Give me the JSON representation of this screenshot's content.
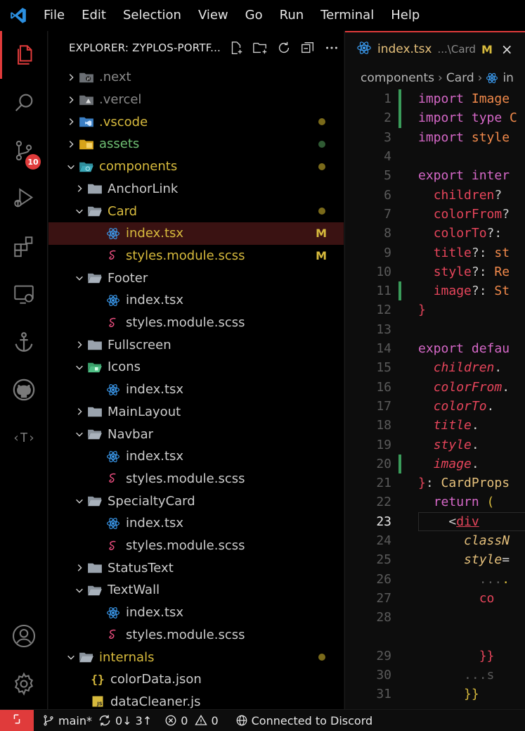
{
  "titlebar": {
    "menu": [
      "File",
      "Edit",
      "Selection",
      "View",
      "Go",
      "Run",
      "Terminal",
      "Help"
    ]
  },
  "activity_bar": {
    "icons": [
      "explorer-icon",
      "search-icon",
      "source-control-icon",
      "run-debug-icon",
      "extensions-icon",
      "remote-explorer-icon",
      "anchor-icon",
      "github-icon",
      "tag-icon",
      "account-icon",
      "settings-gear-icon"
    ],
    "scm_badge": "10"
  },
  "explorer": {
    "title": "EXPLORER: ZYPLOS-PORTF...",
    "header_icons": [
      "new-file-icon",
      "new-folder-icon",
      "refresh-icon",
      "collapse-all-icon",
      "more-icon"
    ],
    "rows": [
      {
        "label": ".next",
        "depth": 0,
        "kind": "folder",
        "expanded": false,
        "color": "#8a8a8a",
        "icon": "next-folder-icon",
        "dot": null,
        "deco": ""
      },
      {
        "label": ".vercel",
        "depth": 0,
        "kind": "folder",
        "expanded": false,
        "color": "#8a8a8a",
        "icon": "vercel-folder-icon",
        "dot": null,
        "deco": ""
      },
      {
        "label": ".vscode",
        "depth": 0,
        "kind": "folder",
        "expanded": false,
        "color": "#d7ba3d",
        "icon": "vscode-folder-icon",
        "dot": "#7a6a1a",
        "deco": ""
      },
      {
        "label": "assets",
        "depth": 0,
        "kind": "folder",
        "expanded": false,
        "color": "#6fbf73",
        "icon": "assets-folder-icon",
        "dot": "#2f5a33",
        "deco": ""
      },
      {
        "label": "components",
        "depth": 0,
        "kind": "folder",
        "expanded": true,
        "color": "#d7ba3d",
        "icon": "components-folder-icon",
        "dot": "#7a6a1a",
        "deco": ""
      },
      {
        "label": "AnchorLink",
        "depth": 1,
        "kind": "folder",
        "expanded": false,
        "color": "#cccccc",
        "icon": "folder-icon",
        "dot": null,
        "deco": ""
      },
      {
        "label": "Card",
        "depth": 1,
        "kind": "folder",
        "expanded": true,
        "color": "#d7ba3d",
        "icon": "folder-open-icon",
        "dot": "#7a6a1a",
        "deco": ""
      },
      {
        "label": "index.tsx",
        "depth": 2,
        "kind": "tsx",
        "color": "#d7ba3d",
        "icon": "react-icon",
        "dot": null,
        "deco": "M",
        "selected": true
      },
      {
        "label": "styles.module.scss",
        "depth": 2,
        "kind": "scss",
        "color": "#d7ba3d",
        "icon": "sass-icon",
        "dot": null,
        "deco": "M"
      },
      {
        "label": "Footer",
        "depth": 1,
        "kind": "folder",
        "expanded": true,
        "color": "#cccccc",
        "icon": "folder-open-icon",
        "dot": null,
        "deco": ""
      },
      {
        "label": "index.tsx",
        "depth": 2,
        "kind": "tsx",
        "color": "#cccccc",
        "icon": "react-icon",
        "dot": null,
        "deco": ""
      },
      {
        "label": "styles.module.scss",
        "depth": 2,
        "kind": "scss",
        "color": "#cccccc",
        "icon": "sass-icon",
        "dot": null,
        "deco": ""
      },
      {
        "label": "Fullscreen",
        "depth": 1,
        "kind": "folder",
        "expanded": false,
        "color": "#cccccc",
        "icon": "folder-icon",
        "dot": null,
        "deco": ""
      },
      {
        "label": "Icons",
        "depth": 1,
        "kind": "folder",
        "expanded": true,
        "color": "#cccccc",
        "icon": "icons-folder-icon",
        "dot": null,
        "deco": ""
      },
      {
        "label": "index.tsx",
        "depth": 2,
        "kind": "tsx",
        "color": "#cccccc",
        "icon": "react-icon",
        "dot": null,
        "deco": ""
      },
      {
        "label": "MainLayout",
        "depth": 1,
        "kind": "folder",
        "expanded": false,
        "color": "#cccccc",
        "icon": "folder-icon",
        "dot": null,
        "deco": ""
      },
      {
        "label": "Navbar",
        "depth": 1,
        "kind": "folder",
        "expanded": true,
        "color": "#cccccc",
        "icon": "folder-open-icon",
        "dot": null,
        "deco": ""
      },
      {
        "label": "index.tsx",
        "depth": 2,
        "kind": "tsx",
        "color": "#cccccc",
        "icon": "react-icon",
        "dot": null,
        "deco": ""
      },
      {
        "label": "styles.module.scss",
        "depth": 2,
        "kind": "scss",
        "color": "#cccccc",
        "icon": "sass-icon",
        "dot": null,
        "deco": ""
      },
      {
        "label": "SpecialtyCard",
        "depth": 1,
        "kind": "folder",
        "expanded": true,
        "color": "#cccccc",
        "icon": "folder-open-icon",
        "dot": null,
        "deco": ""
      },
      {
        "label": "index.tsx",
        "depth": 2,
        "kind": "tsx",
        "color": "#cccccc",
        "icon": "react-icon",
        "dot": null,
        "deco": ""
      },
      {
        "label": "styles.module.scss",
        "depth": 2,
        "kind": "scss",
        "color": "#cccccc",
        "icon": "sass-icon",
        "dot": null,
        "deco": ""
      },
      {
        "label": "StatusText",
        "depth": 1,
        "kind": "folder",
        "expanded": false,
        "color": "#cccccc",
        "icon": "folder-icon",
        "dot": null,
        "deco": ""
      },
      {
        "label": "TextWall",
        "depth": 1,
        "kind": "folder",
        "expanded": true,
        "color": "#cccccc",
        "icon": "folder-open-icon",
        "dot": null,
        "deco": ""
      },
      {
        "label": "index.tsx",
        "depth": 2,
        "kind": "tsx",
        "color": "#cccccc",
        "icon": "react-icon",
        "dot": null,
        "deco": ""
      },
      {
        "label": "styles.module.scss",
        "depth": 2,
        "kind": "scss",
        "color": "#cccccc",
        "icon": "sass-icon",
        "dot": null,
        "deco": ""
      },
      {
        "label": "internals",
        "depth": 0,
        "kind": "folder",
        "expanded": true,
        "color": "#d7ba3d",
        "icon": "folder-open-icon",
        "dot": "#7a6a1a",
        "deco": ""
      },
      {
        "label": "colorData.json",
        "depth": 1,
        "kind": "json",
        "color": "#cccccc",
        "icon": "json-icon",
        "dot": null,
        "deco": ""
      },
      {
        "label": "dataCleaner.js",
        "depth": 1,
        "kind": "js",
        "color": "#cccccc",
        "icon": "js-icon",
        "dot": null,
        "deco": ""
      }
    ]
  },
  "editor": {
    "tab": {
      "name": "index.tsx",
      "path": "...\\Card",
      "status": "M",
      "close": "×"
    },
    "breadcrumbs": [
      "components",
      "Card",
      "in"
    ],
    "active_line": 23,
    "lines": [
      {
        "n": "1",
        "mod": true,
        "tokens": [
          [
            "kw",
            "import "
          ],
          [
            "ty",
            "Image"
          ]
        ]
      },
      {
        "n": "2",
        "mod": true,
        "tokens": [
          [
            "kw",
            "import "
          ],
          [
            "kw",
            "type "
          ],
          [
            "ty",
            "C"
          ]
        ]
      },
      {
        "n": "3",
        "mod": false,
        "tokens": [
          [
            "kw",
            "import "
          ],
          [
            "ty",
            "style"
          ]
        ]
      },
      {
        "n": "4",
        "mod": false,
        "tokens": []
      },
      {
        "n": "5",
        "mod": false,
        "tokens": [
          [
            "kw",
            "export "
          ],
          [
            "kw",
            "inter"
          ]
        ]
      },
      {
        "n": "6",
        "mod": false,
        "tokens": [
          [
            "punc",
            "  "
          ],
          [
            "prop",
            "children"
          ],
          [
            "punc",
            "?"
          ]
        ]
      },
      {
        "n": "7",
        "mod": false,
        "tokens": [
          [
            "punc",
            "  "
          ],
          [
            "prop",
            "colorFrom"
          ],
          [
            "punc",
            "?"
          ]
        ]
      },
      {
        "n": "8",
        "mod": false,
        "tokens": [
          [
            "punc",
            "  "
          ],
          [
            "prop",
            "colorTo"
          ],
          [
            "punc",
            "?: "
          ]
        ]
      },
      {
        "n": "9",
        "mod": false,
        "tokens": [
          [
            "punc",
            "  "
          ],
          [
            "prop",
            "title"
          ],
          [
            "punc",
            "?: "
          ],
          [
            "ty",
            "st"
          ]
        ]
      },
      {
        "n": "10",
        "mod": false,
        "tokens": [
          [
            "punc",
            "  "
          ],
          [
            "prop",
            "style"
          ],
          [
            "punc",
            "?: "
          ],
          [
            "ty",
            "Re"
          ]
        ]
      },
      {
        "n": "11",
        "mod": true,
        "tokens": [
          [
            "punc",
            "  "
          ],
          [
            "prop",
            "image"
          ],
          [
            "punc",
            "?: "
          ],
          [
            "ty",
            "St"
          ]
        ]
      },
      {
        "n": "12",
        "mod": false,
        "tokens": [
          [
            "brace",
            "}"
          ]
        ]
      },
      {
        "n": "13",
        "mod": false,
        "tokens": []
      },
      {
        "n": "14",
        "mod": false,
        "tokens": [
          [
            "kw",
            "export "
          ],
          [
            "kw",
            "defau"
          ]
        ]
      },
      {
        "n": "15",
        "mod": false,
        "tokens": [
          [
            "punc",
            "  "
          ],
          [
            "prop-i",
            "children"
          ],
          [
            "punc",
            "."
          ]
        ]
      },
      {
        "n": "16",
        "mod": false,
        "tokens": [
          [
            "punc",
            "  "
          ],
          [
            "prop-i",
            "colorFrom"
          ],
          [
            "punc",
            "."
          ]
        ]
      },
      {
        "n": "17",
        "mod": false,
        "tokens": [
          [
            "punc",
            "  "
          ],
          [
            "prop-i",
            "colorTo"
          ],
          [
            "punc",
            "."
          ]
        ]
      },
      {
        "n": "18",
        "mod": false,
        "tokens": [
          [
            "punc",
            "  "
          ],
          [
            "prop-i",
            "title"
          ],
          [
            "punc",
            "."
          ]
        ]
      },
      {
        "n": "19",
        "mod": false,
        "tokens": [
          [
            "punc",
            "  "
          ],
          [
            "prop-i",
            "style"
          ],
          [
            "punc",
            "."
          ]
        ]
      },
      {
        "n": "20",
        "mod": true,
        "tokens": [
          [
            "punc",
            "  "
          ],
          [
            "prop-i",
            "image"
          ],
          [
            "punc",
            "."
          ]
        ]
      },
      {
        "n": "21",
        "mod": false,
        "tokens": [
          [
            "brace",
            "}"
          ],
          [
            "punc",
            ": "
          ],
          [
            "fn",
            "CardProps"
          ]
        ]
      },
      {
        "n": "22",
        "mod": false,
        "tokens": [
          [
            "punc",
            "  "
          ],
          [
            "kw",
            "return "
          ],
          [
            "brace2",
            "("
          ]
        ]
      },
      {
        "n": "23",
        "mod": false,
        "tokens": [
          [
            "punc",
            "    <"
          ],
          [
            "tag",
            "div"
          ]
        ]
      },
      {
        "n": "24",
        "mod": false,
        "tokens": [
          [
            "punc",
            "      "
          ],
          [
            "attr",
            "classN"
          ]
        ]
      },
      {
        "n": "25",
        "mod": false,
        "tokens": [
          [
            "punc",
            "      "
          ],
          [
            "attr",
            "style"
          ],
          [
            "punc",
            "="
          ]
        ]
      },
      {
        "n": "26",
        "mod": false,
        "tokens": [
          [
            "dim",
            "        ..."
          ],
          [
            "brace2",
            "."
          ]
        ]
      },
      {
        "n": "27",
        "mod": false,
        "tokens": [
          [
            "punc",
            "        "
          ],
          [
            "prop",
            "co"
          ]
        ]
      },
      {
        "n": "28",
        "mod": false,
        "tokens": []
      },
      {
        "n": "",
        "mod": false,
        "tokens": []
      },
      {
        "n": "29",
        "mod": false,
        "tokens": [
          [
            "punc",
            "        "
          ],
          [
            "brace",
            "}}"
          ]
        ]
      },
      {
        "n": "30",
        "mod": false,
        "tokens": [
          [
            "dim",
            "      ...s"
          ]
        ]
      },
      {
        "n": "31",
        "mod": false,
        "tokens": [
          [
            "punc",
            "      "
          ],
          [
            "brace2",
            "}}"
          ]
        ]
      }
    ]
  },
  "statusbar": {
    "branch": "main*",
    "sync": "0↓ 3↑",
    "errors": "0",
    "warnings": "0",
    "discord": "Connected to Discord"
  },
  "colors": {
    "accent": "#e03b3b",
    "modified": "#d7ba3d",
    "git_added": "#3a9b5a"
  }
}
